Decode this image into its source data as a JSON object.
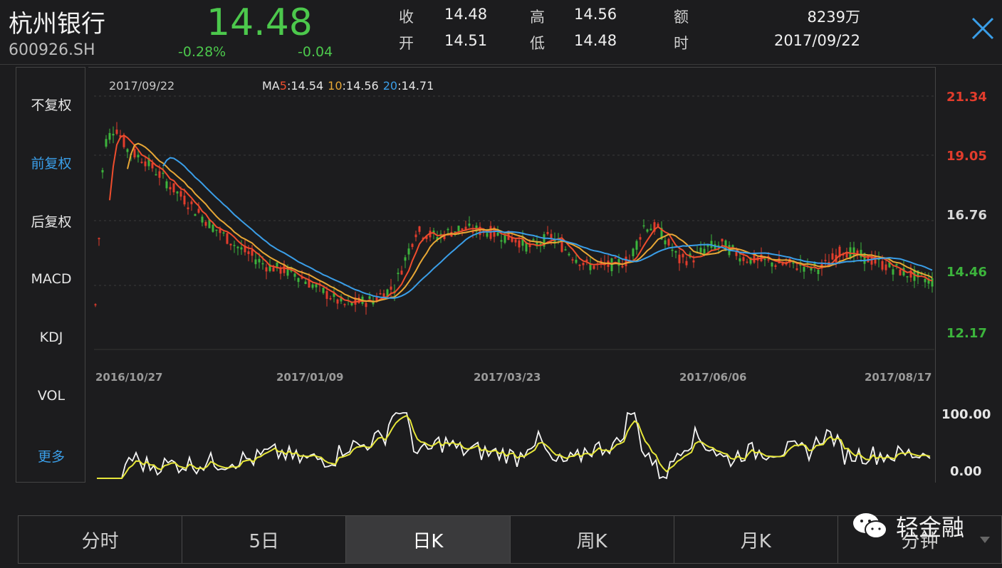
{
  "stock": {
    "name": "杭州银行",
    "code": "600926.SH",
    "price": "14.48",
    "change_pct": "-0.28%",
    "change": "-0.04"
  },
  "quote": {
    "close_label": "收",
    "close_value": "14.48",
    "open_label": "开",
    "open_value": "14.51",
    "high_label": "高",
    "high_value": "14.56",
    "low_label": "低",
    "low_value": "14.48",
    "amount_label": "额",
    "amount_value": "8239万",
    "time_label": "时",
    "time_value": "2017/09/22"
  },
  "side_menu": [
    "不复权",
    "前复权",
    "后复权",
    "MACD",
    "KDJ",
    "VOL",
    "更多"
  ],
  "chart": {
    "date_label": "2017/09/22",
    "ma_prefix": "MA",
    "ma5_key": "5",
    "ma5_val": ":14.54",
    "ma10_key": "10",
    "ma10_val": ":14.56",
    "ma20_key": "20",
    "ma20_val": ":14.71",
    "y_ticks": [
      "21.34",
      "19.05",
      "16.76",
      "14.46",
      "12.17"
    ],
    "x_ticks": [
      "2016/10/27",
      "2017/01/09",
      "2017/03/23",
      "2017/06/06",
      "2017/08/17"
    ],
    "osc_ticks": [
      "100.00",
      "0.00"
    ],
    "colors": {
      "up": "#e23c2c",
      "down": "#3cb43c",
      "ma5": "#ef4d2d",
      "ma10": "#e8a735",
      "ma20": "#3a9ee8",
      "k_line": "#f5f5f5",
      "d_line": "#e6e63a"
    }
  },
  "tabs": [
    "分时",
    "5日",
    "日K",
    "周K",
    "月K",
    "分钟"
  ],
  "watermark": {
    "text": "轻金融",
    "icon": "wechat-icon"
  }
}
